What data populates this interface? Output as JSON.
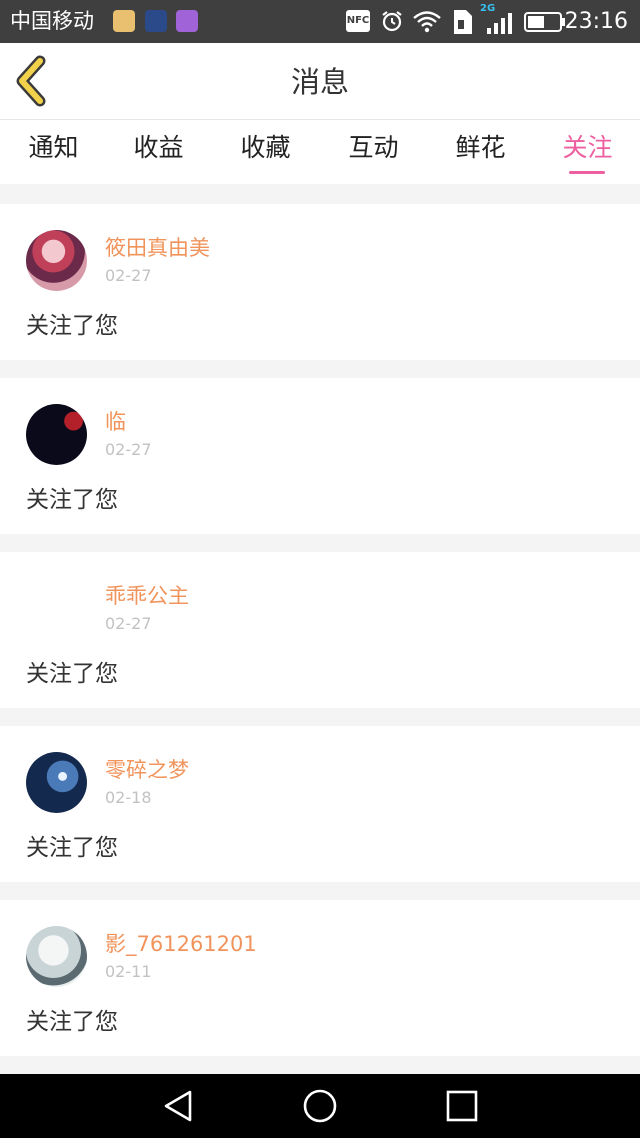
{
  "status_bar": {
    "carrier": "中国移动",
    "nfc": "NFC",
    "network": "2G",
    "time": "23:16",
    "icons": [
      "app-notification-icon",
      "app-notification-icon",
      "gallery-icon",
      "nfc-icon",
      "alarm-icon",
      "wifi-icon",
      "sim-icon",
      "signal-icon",
      "battery-icon"
    ]
  },
  "header": {
    "title": "消息",
    "back_icon": "chevron-left-icon",
    "accent_color": "#ee5fa0"
  },
  "tabs": [
    {
      "label": "通知",
      "active": false
    },
    {
      "label": "收益",
      "active": false
    },
    {
      "label": "收藏",
      "active": false
    },
    {
      "label": "互动",
      "active": false
    },
    {
      "label": "鲜花",
      "active": false
    },
    {
      "label": "关注",
      "active": true
    }
  ],
  "items": [
    {
      "username": "筱田真由美",
      "date": "02-27",
      "message": "关注了您"
    },
    {
      "username": "临",
      "date": "02-27",
      "message": "关注了您"
    },
    {
      "username": "乖乖公主",
      "date": "02-27",
      "message": "关注了您"
    },
    {
      "username": "零碎之梦",
      "date": "02-18",
      "message": "关注了您"
    },
    {
      "username": "影_761261201",
      "date": "02-11",
      "message": "关注了您"
    }
  ],
  "nav_bar": {
    "icons": [
      "back-triangle-icon",
      "home-circle-icon",
      "recents-square-icon"
    ]
  }
}
